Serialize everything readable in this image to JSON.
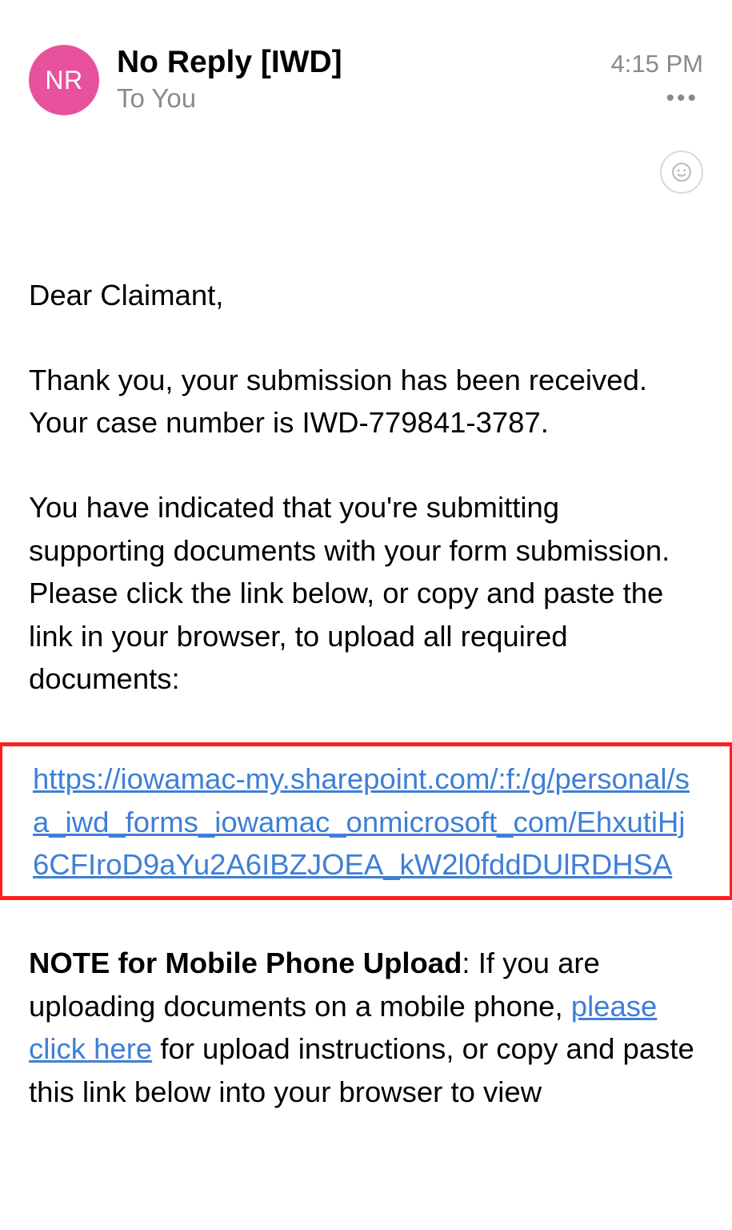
{
  "header": {
    "avatar_initials": "NR",
    "sender_name": "No Reply [IWD]",
    "timestamp": "4:15 PM",
    "recipient": "To You"
  },
  "body": {
    "greeting": "Dear Claimant,",
    "p1": "Thank you, your submission has been received.  Your case number is IWD-779841-3787.",
    "p2": "You have indicated that you're submitting supporting documents with your form submission. Please click the link below, or copy and paste the link in your browser, to upload all required documents:",
    "upload_link": "https://iowamac-my.sharepoint.com/:f:/g/personal/sa_iwd_forms_iowamac_onmicrosoft_com/EhxutiHj6CFIroD9aYu2A6IBZJOEA_kW2l0fddDUlRDHSA",
    "note_label": "NOTE for Mobile Phone Upload",
    "note_before": ": If you are uploading documents on a mobile phone, ",
    "note_link": "please click here",
    "note_after": " for upload instructions, or copy and paste this link below into your browser to view"
  }
}
